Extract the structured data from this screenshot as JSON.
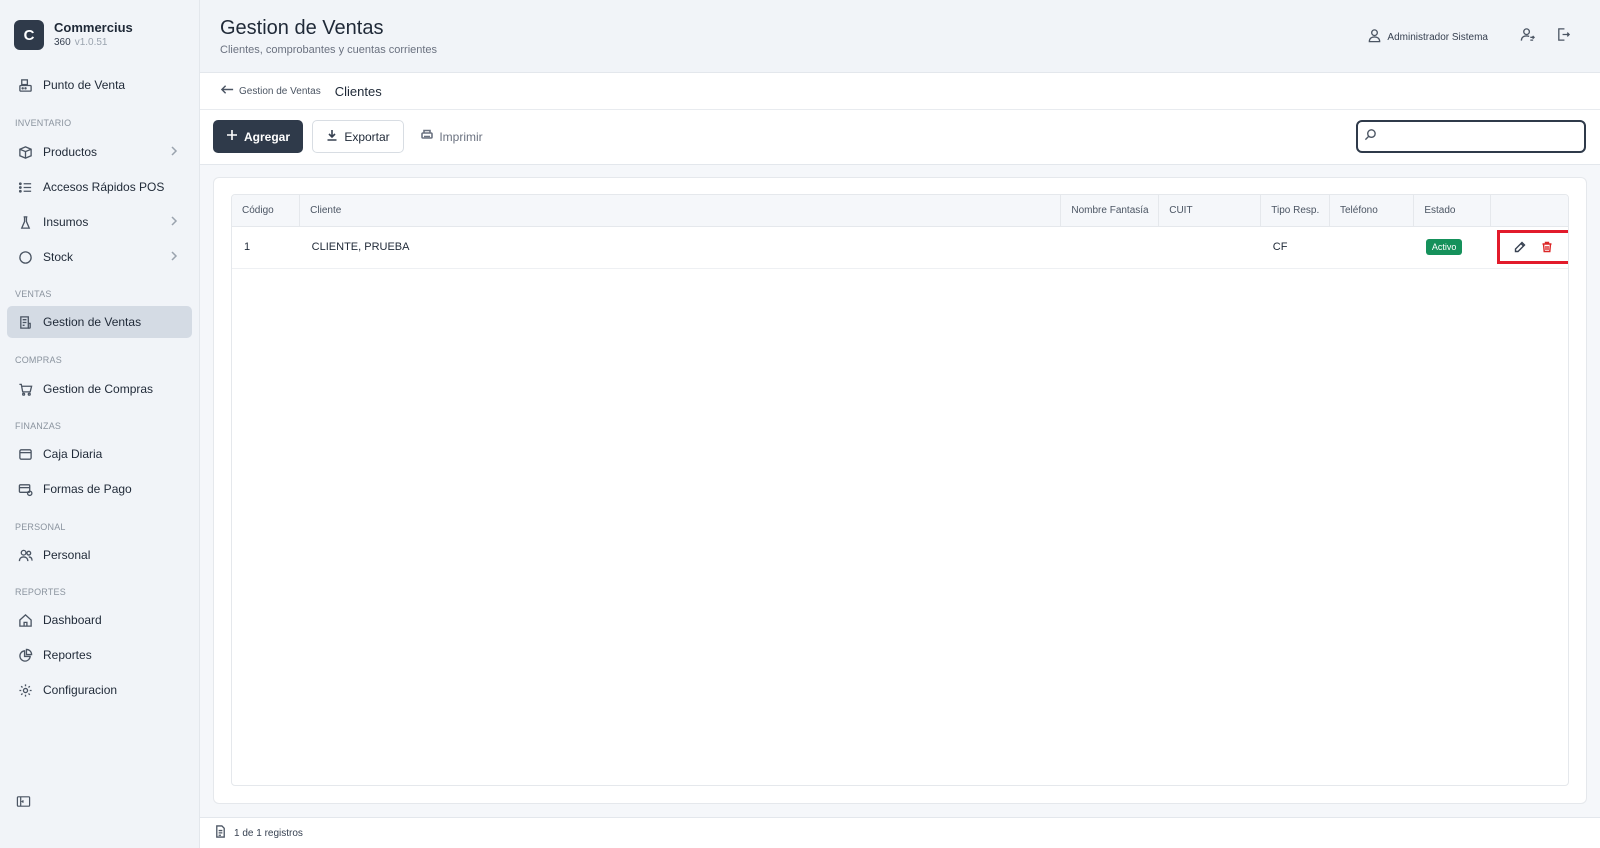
{
  "brand": {
    "initial": "C",
    "name": "Commercius",
    "sub": "360",
    "version": "v1.0.51"
  },
  "sidebar": {
    "items": [
      {
        "label": "Punto de Venta",
        "icon": "register-icon"
      },
      {
        "label": "Productos",
        "icon": "box-icon",
        "chevron": true
      },
      {
        "label": "Accesos Rápidos POS",
        "icon": "list-icon"
      },
      {
        "label": "Insumos",
        "icon": "flask-icon",
        "chevron": true
      },
      {
        "label": "Stock",
        "icon": "circle-icon",
        "chevron": true
      },
      {
        "label": "Gestion de Ventas",
        "icon": "receipt-icon",
        "active": true
      },
      {
        "label": "Gestion de Compras",
        "icon": "cart-icon"
      },
      {
        "label": "Caja Diaria",
        "icon": "wallet-icon"
      },
      {
        "label": "Formas de Pago",
        "icon": "card-icon"
      },
      {
        "label": "Personal",
        "icon": "users-icon"
      },
      {
        "label": "Dashboard",
        "icon": "home-icon"
      },
      {
        "label": "Reportes",
        "icon": "pie-icon"
      },
      {
        "label": "Configuracion",
        "icon": "gear-icon"
      }
    ],
    "sections": [
      "INVENTARIO",
      "VENTAS",
      "COMPRAS",
      "FINANZAS",
      "PERSONAL",
      "REPORTES"
    ]
  },
  "header": {
    "title": "Gestion de Ventas",
    "subtitle": "Clientes, comprobantes y cuentas corrientes",
    "user": "Administrador Sistema"
  },
  "breadcrumb": {
    "back": "Gestion de Ventas",
    "current": "Clientes"
  },
  "toolbar": {
    "add_label": "Agregar",
    "export_label": "Exportar",
    "print_label": "Imprimir",
    "search_value": ""
  },
  "table": {
    "columns": [
      "Código",
      "Cliente",
      "Nombre Fantasía",
      "CUIT",
      "Tipo Resp.",
      "Teléfono",
      "Estado",
      ""
    ],
    "rows": [
      {
        "codigo": "1",
        "cliente": "CLIENTE, PRUEBA",
        "fantasia": "",
        "cuit": "",
        "tipo": "CF",
        "telefono": "",
        "estado": "Activo"
      }
    ]
  },
  "footer": {
    "records": "1 de 1 registros"
  },
  "colors": {
    "primary": "#2f3a4a",
    "success": "#15915b",
    "danger": "#dc2626",
    "highlight": "#e21b2b"
  }
}
